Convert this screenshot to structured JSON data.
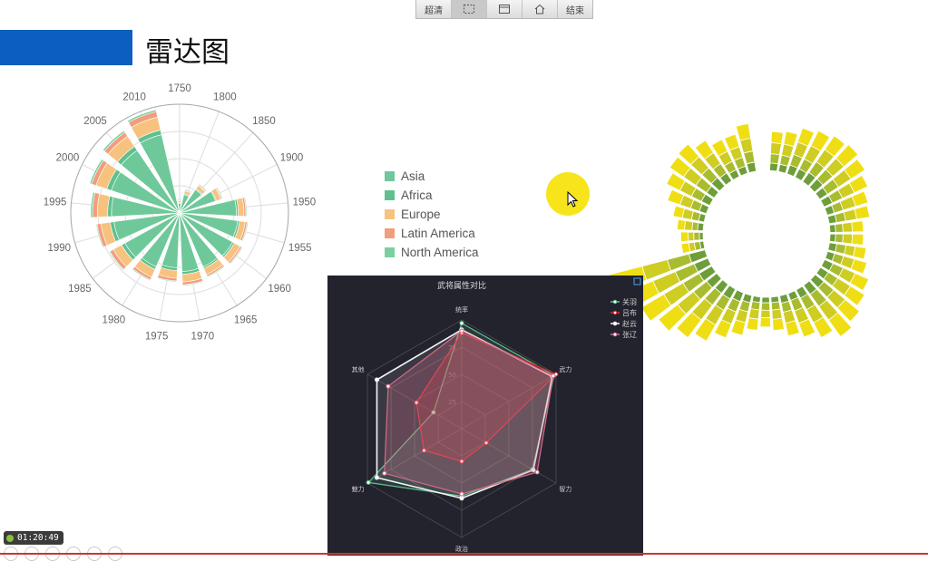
{
  "toolbar": {
    "items": [
      {
        "label": "超清",
        "icon": null,
        "active": false
      },
      {
        "label": "",
        "icon": "selection-icon",
        "active": true
      },
      {
        "label": "",
        "icon": "window-icon",
        "active": false
      },
      {
        "label": "",
        "icon": "home-icon",
        "active": false
      },
      {
        "label": "结束",
        "icon": null,
        "active": false
      }
    ]
  },
  "page": {
    "title": "雷达图",
    "accent_color": "#0a5fc0"
  },
  "timer": "01:20:49",
  "chart_data": [
    {
      "type": "bar",
      "subtype": "polar-stacked-bar",
      "angle_labels": [
        "1750",
        "1800",
        "1850",
        "1900",
        "1950",
        "1955",
        "1960",
        "1965",
        "1970",
        "1975",
        "1980",
        "1985",
        "1990",
        "1995",
        "2000",
        "2005",
        "2010"
      ],
      "legend": [
        {
          "name": "Asia",
          "color": "#6fc89a"
        },
        {
          "name": "Africa",
          "color": "#5fc08f"
        },
        {
          "name": "Europe",
          "color": "#f7c27e"
        },
        {
          "name": "Latin America",
          "color": "#f29d7c"
        },
        {
          "name": "North America",
          "color": "#78d0a0"
        }
      ],
      "series": [
        {
          "name": "Asia",
          "values": [
            10,
            20,
            30,
            40,
            60,
            62,
            64,
            62,
            62,
            58,
            62,
            66,
            70,
            72,
            76,
            80,
            85
          ]
        },
        {
          "name": "Africa",
          "values": [
            1,
            1,
            1,
            1,
            2,
            2,
            2,
            2,
            3,
            3,
            3,
            4,
            4,
            4,
            5,
            5,
            5
          ]
        },
        {
          "name": "Europe",
          "values": [
            2,
            3,
            4,
            5,
            6,
            6,
            7,
            7,
            8,
            8,
            9,
            10,
            10,
            11,
            12,
            13,
            14
          ]
        },
        {
          "name": "Latin America",
          "values": [
            1,
            1,
            1,
            1,
            2,
            2,
            2,
            2,
            3,
            3,
            3,
            4,
            4,
            5,
            5,
            5,
            6
          ]
        },
        {
          "name": "North America",
          "values": [
            1,
            1,
            1,
            1,
            1,
            1,
            1,
            1,
            1,
            1,
            1,
            1,
            1,
            2,
            2,
            2,
            2
          ]
        }
      ]
    },
    {
      "type": "radar",
      "title": "武将属性对比",
      "indicators": [
        "统率",
        "武力",
        "智力",
        "政治",
        "魅力",
        "其他"
      ],
      "ticks": [
        "75",
        "50",
        "25"
      ],
      "max": 100,
      "series": [
        {
          "name": "关羽",
          "color": "#5fbf8a",
          "values": [
            97,
            98,
            75,
            62,
            99,
            30
          ]
        },
        {
          "name": "吕布",
          "color": "#e2242b",
          "values": [
            88,
            100,
            26,
            30,
            40,
            48
          ]
        },
        {
          "name": "赵云",
          "color": "#f4f4f4",
          "values": [
            91,
            96,
            76,
            64,
            90,
            90
          ]
        },
        {
          "name": "张辽",
          "color": "#d36b8a",
          "values": [
            90,
            97,
            80,
            60,
            82,
            78
          ]
        }
      ]
    },
    {
      "type": "bar",
      "subtype": "radial-stacked-bar",
      "colors": [
        "#6e9e3a",
        "#a9bc2f",
        "#cfcc22",
        "#f0de14"
      ],
      "values": [
        [
          4,
          5,
          6,
          6
        ],
        [
          4,
          5,
          6,
          7
        ],
        [
          5,
          6,
          7,
          8
        ],
        [
          5,
          6,
          8,
          9
        ],
        [
          6,
          7,
          8,
          9
        ],
        [
          6,
          7,
          8,
          10
        ],
        [
          5,
          7,
          8,
          9
        ],
        [
          5,
          6,
          7,
          8
        ],
        [
          4,
          5,
          7,
          7
        ],
        [
          4,
          5,
          6,
          7
        ],
        [
          3,
          4,
          5,
          6
        ],
        [
          3,
          4,
          5,
          6
        ],
        [
          4,
          5,
          5,
          6
        ],
        [
          4,
          5,
          6,
          7
        ],
        [
          5,
          6,
          7,
          8
        ],
        [
          5,
          6,
          8,
          9
        ],
        [
          6,
          7,
          8,
          10
        ],
        [
          6,
          8,
          9,
          11
        ],
        [
          5,
          7,
          8,
          9
        ],
        [
          4,
          6,
          7,
          8
        ],
        [
          4,
          5,
          6,
          7
        ],
        [
          3,
          4,
          5,
          6
        ],
        [
          3,
          4,
          4,
          5
        ],
        [
          3,
          4,
          5,
          6
        ],
        [
          4,
          5,
          6,
          7
        ],
        [
          5,
          6,
          7,
          8
        ],
        [
          6,
          7,
          9,
          10
        ],
        [
          6,
          8,
          10,
          12
        ],
        [
          7,
          9,
          11,
          13
        ],
        [
          8,
          10,
          12,
          14
        ],
        [
          8,
          11,
          13,
          16
        ],
        [
          9,
          12,
          14,
          18
        ],
        [
          2,
          3,
          3,
          4
        ],
        [
          2,
          3,
          3,
          4
        ],
        [
          3,
          3,
          4,
          4
        ],
        [
          3,
          4,
          5,
          5
        ],
        [
          4,
          5,
          6,
          7
        ],
        [
          5,
          6,
          7,
          8
        ],
        [
          5,
          7,
          8,
          9
        ],
        [
          6,
          7,
          8,
          9
        ],
        [
          5,
          6,
          7,
          8
        ],
        [
          4,
          5,
          6,
          7
        ],
        [
          4,
          5,
          6,
          7
        ],
        [
          5,
          6,
          7,
          8
        ]
      ]
    }
  ]
}
